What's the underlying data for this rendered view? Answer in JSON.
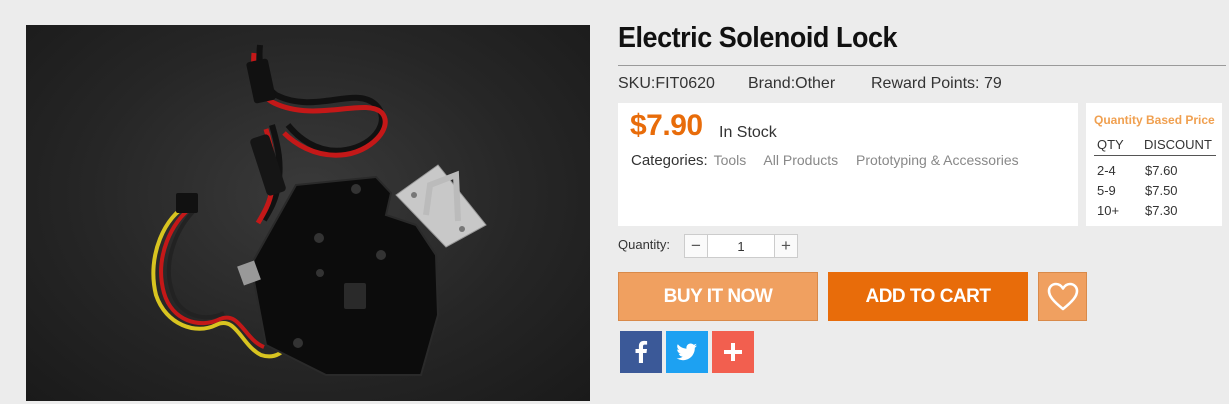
{
  "product": {
    "title": "Electric Solenoid Lock",
    "sku": "SKU:FIT0620",
    "brand": "Brand:Other",
    "reward_points": "Reward Points: 79",
    "price": "$7.90",
    "stock_status": "In Stock",
    "categories_label": "Categories:",
    "categories": [
      "Tools",
      "All Products",
      "Prototyping & Accessories"
    ]
  },
  "quantity_pricing": {
    "title": "Quantity Based Price",
    "col_qty": "QTY",
    "col_discount": "DISCOUNT",
    "rows": [
      {
        "range": "2-4",
        "price": "$7.60"
      },
      {
        "range": "5-9",
        "price": "$7.50"
      },
      {
        "range": "10+",
        "price": "$7.30"
      }
    ]
  },
  "quantity": {
    "label": "Quantity:",
    "value": "1",
    "minus": "−",
    "plus": "+"
  },
  "actions": {
    "buy_now": "BUY IT NOW",
    "add_to_cart": "ADD TO CART",
    "wishlist_icon": "heart-icon"
  },
  "share": {
    "facebook_icon": "facebook-icon",
    "twitter_icon": "twitter-icon",
    "more_icon": "plus-icon"
  },
  "colors": {
    "accent": "#e86c0a",
    "accent_light": "#f0a060",
    "facebook": "#3b5998",
    "twitter": "#1da1f2",
    "share_more": "#f25f4f"
  }
}
